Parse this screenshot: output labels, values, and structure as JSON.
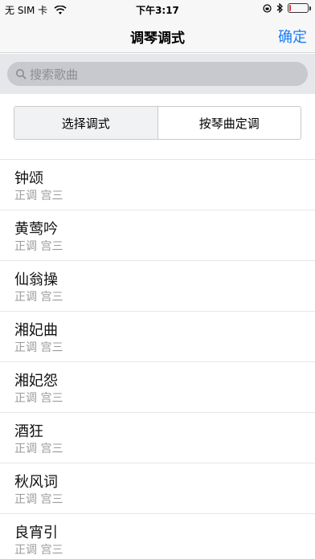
{
  "status_bar": {
    "carrier": "无 SIM 卡",
    "time": "下午3:17",
    "battery_level": 0.1,
    "battery_color": "#e53935"
  },
  "nav": {
    "title": "调琴调式",
    "confirm_label": "确定",
    "accent_color": "#1a7cf5"
  },
  "search": {
    "placeholder": "搜索歌曲",
    "icon": "search-icon"
  },
  "segment": {
    "options": [
      {
        "label": "选择调式",
        "selected": true
      },
      {
        "label": "按琴曲定调",
        "selected": false
      }
    ]
  },
  "songs": [
    {
      "title": "钟颂",
      "subtitle": "正调 宫三"
    },
    {
      "title": "黄莺吟",
      "subtitle": "正调 宫三"
    },
    {
      "title": "仙翁操",
      "subtitle": "正调 宫三"
    },
    {
      "title": "湘妃曲",
      "subtitle": "正调 宫三"
    },
    {
      "title": "湘妃怨",
      "subtitle": "正调 宫三"
    },
    {
      "title": "酒狂",
      "subtitle": "正调 宫三"
    },
    {
      "title": "秋风词",
      "subtitle": "正调 宫三"
    },
    {
      "title": "良宵引",
      "subtitle": "正调 宫三"
    }
  ]
}
